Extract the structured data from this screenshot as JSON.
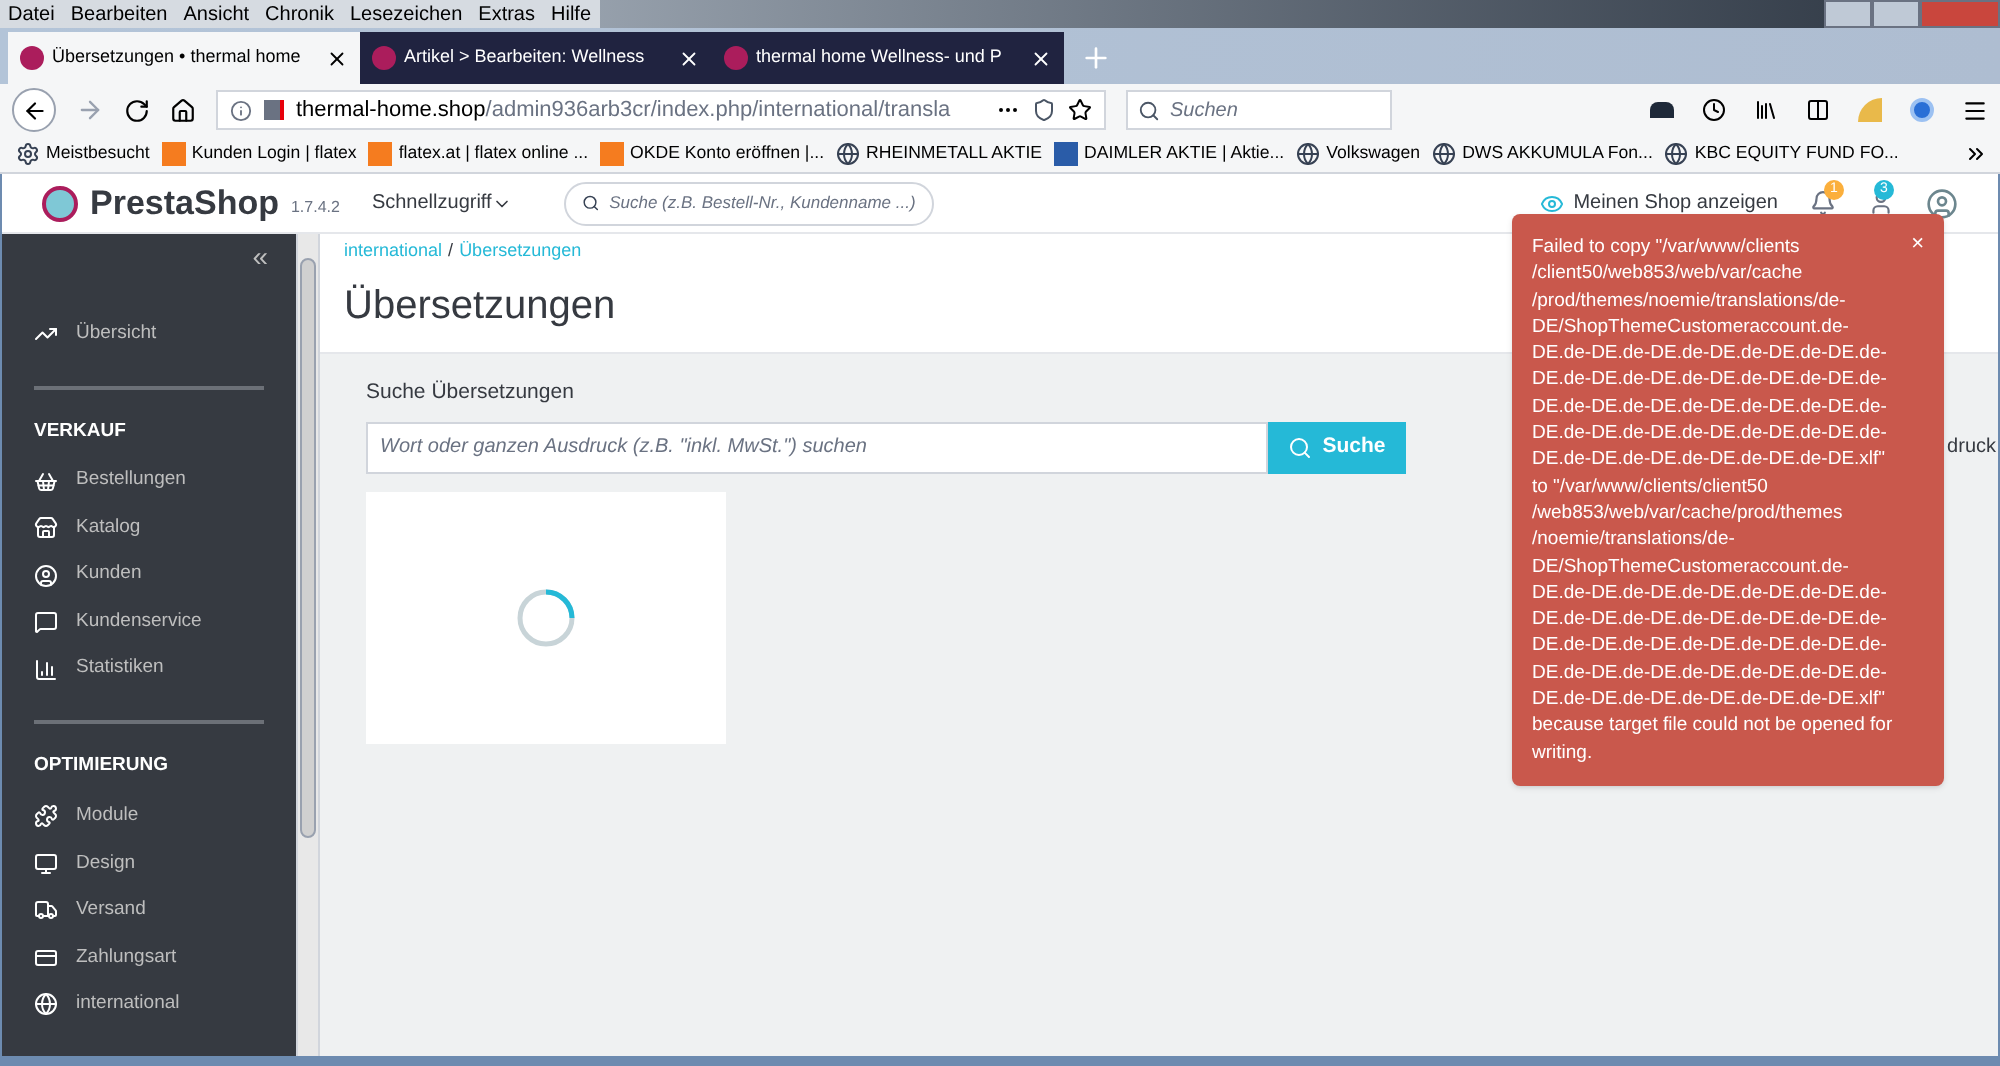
{
  "menu_bar": [
    "Datei",
    "Bearbeiten",
    "Ansicht",
    "Chronik",
    "Lesezeichen",
    "Extras",
    "Hilfe"
  ],
  "tabs": [
    {
      "label": "Übersetzungen • thermal home",
      "selected": true
    },
    {
      "label": "Artikel > Bearbeiten: Wellness",
      "selected": false
    },
    {
      "label": "thermal home Wellness- und P",
      "selected": false
    }
  ],
  "address": {
    "host": "thermal-home.shop",
    "path": "/admin936arb3cr/index.php/international/transla"
  },
  "browser_search": {
    "placeholder": "Suchen"
  },
  "bookmarks": [
    {
      "label": "Meistbesucht",
      "kind": "gear"
    },
    {
      "label": "Kunden Login | flatex",
      "kind": "flatex"
    },
    {
      "label": "flatex.at | flatex online ...",
      "kind": "flatex"
    },
    {
      "label": "OKDE Konto eröffnen |...",
      "kind": "flatex"
    },
    {
      "label": "RHEINMETALL AKTIE",
      "kind": "globe"
    },
    {
      "label": "DAIMLER AKTIE | Aktie...",
      "kind": "chart"
    },
    {
      "label": "Volkswagen",
      "kind": "globe"
    },
    {
      "label": "DWS AKKUMULA Fon...",
      "kind": "globe"
    },
    {
      "label": "KBC EQUITY FUND FO...",
      "kind": "globe"
    }
  ],
  "header": {
    "logo": "PrestaShop",
    "version": "1.7.4.2",
    "quick_access": "Schnellzugriff",
    "search": {
      "placeholder": "Suche (z.B. Bestell-Nr., Kundenname ...)"
    },
    "view_shop": "Meinen Shop anzeigen",
    "notifications": "1",
    "messages": "3"
  },
  "sidebar": {
    "collapse": "«",
    "sections": [
      {
        "items": [
          {
            "label": "Übersicht"
          }
        ]
      },
      {
        "title": "VERKAUF",
        "items": [
          {
            "label": "Bestellungen"
          },
          {
            "label": "Katalog"
          },
          {
            "label": "Kunden"
          },
          {
            "label": "Kundenservice"
          },
          {
            "label": "Statistiken"
          }
        ]
      },
      {
        "title": "OPTIMIERUNG",
        "items": [
          {
            "label": "Module"
          },
          {
            "label": "Design"
          },
          {
            "label": "Versand"
          },
          {
            "label": "Zahlungsart"
          },
          {
            "label": "international"
          }
        ]
      }
    ]
  },
  "breadcrumb": [
    "international",
    "Übersetzungen"
  ],
  "breadcrumb_separator": "/",
  "page_title": "Übersetzungen",
  "search": {
    "label": "Suche Übersetzungen",
    "placeholder": "Wort oder ganzen Ausdruck (z.B. \"inkl. MwSt.\") suchen",
    "button": "Suche"
  },
  "counter_fragment": "druck",
  "toast": {
    "message": "Failed to copy \"/var/www/clients /client50/web853/web/var/cache /prod/themes/noemie/translations/de-DE/ShopThemeCustomeraccount.de-DE.de-DE.de-DE.de-DE.de-DE.de-DE.de-DE.de-DE.de-DE.de-DE.de-DE.de-DE.de-DE.de-DE.de-DE.de-DE.de-DE.de-DE.de-DE.de-DE.de-DE.de-DE.de-DE.de-DE.de-DE.de-DE.de-DE.de-DE.de-DE.de-DE.xlf\" to \"/var/www/clients/client50 /web853/web/var/cache/prod/themes /noemie/translations/de-DE/ShopThemeCustomeraccount.de-DE.de-DE.de-DE.de-DE.de-DE.de-DE.de-DE.de-DE.de-DE.de-DE.de-DE.de-DE.de-DE.de-DE.de-DE.de-DE.de-DE.de-DE.de-DE.de-DE.de-DE.de-DE.de-DE.de-DE.de-DE.de-DE.de-DE.de-DE.de-DE.de-DE.xlf\" because target file could not be opened for writing.",
    "close": "×"
  }
}
